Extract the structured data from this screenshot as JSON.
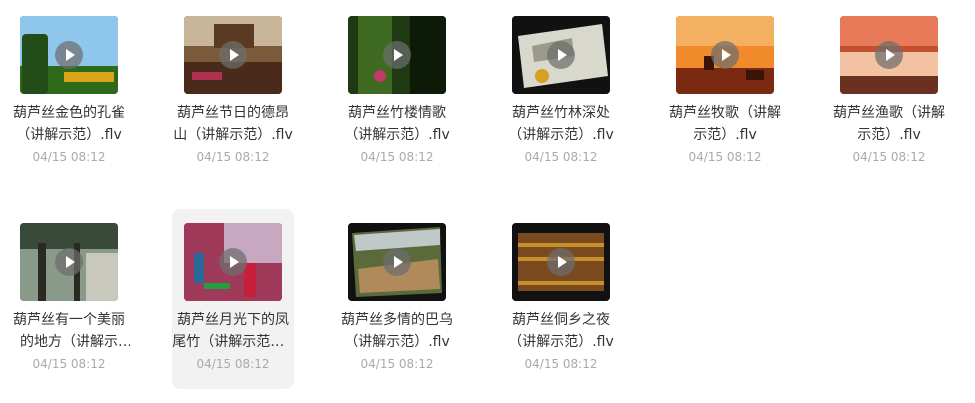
{
  "files": [
    {
      "name": "葫芦丝金色的孔雀（讲解示范）.flv",
      "date": "04/15 08:12",
      "thumb": "landscape-peacock-icon",
      "colors": [
        "#8fc7ec",
        "#2f6a1a",
        "#d9a31a"
      ]
    },
    {
      "name": "葫芦丝节日的德昂山（讲解示范）.flv",
      "date": "04/15 08:12",
      "thumb": "festival-crowd-icon",
      "colors": [
        "#7a5a3a",
        "#c9b59a",
        "#4a2a1a"
      ]
    },
    {
      "name": "葫芦丝竹楼情歌（讲解示范）.flv",
      "date": "04/15 08:12",
      "thumb": "bamboo-house-icon",
      "colors": [
        "#1f3a12",
        "#3e6a22",
        "#c13a6a"
      ]
    },
    {
      "name": "葫芦丝竹林深处（讲解示范）.flv",
      "date": "04/15 08:12",
      "thumb": "bamboo-forest-icon",
      "colors": [
        "#111111",
        "#d8d8cc",
        "#9a9a8a"
      ]
    },
    {
      "name": "葫芦丝牧歌（讲解示范）.flv",
      "date": "04/15 08:12",
      "thumb": "sunset-herder-icon",
      "colors": [
        "#f08a2a",
        "#f2b060",
        "#7a2a10"
      ]
    },
    {
      "name": "葫芦丝渔歌（讲解示范）.flv",
      "date": "04/15 08:12",
      "thumb": "lake-sunset-icon",
      "colors": [
        "#e87a5a",
        "#f2c2a2",
        "#6a3020"
      ]
    },
    {
      "name": "葫芦丝有一个美丽的地方（讲解示范）.flv",
      "date": "04/15 08:12",
      "thumb": "banyan-tree-icon",
      "colors": [
        "#8a9a8a",
        "#3a4a3a",
        "#c8c8bc"
      ]
    },
    {
      "name": "葫芦丝月光下的凤尾竹（讲解示范）.flv",
      "date": "04/15 08:12",
      "thumb": "dancers-icon",
      "colors": [
        "#a03a5a",
        "#c8a8c0",
        "#2a6a9a"
      ]
    },
    {
      "name": "葫芦丝多情的巴乌（讲解示范）.flv",
      "date": "04/15 08:12",
      "thumb": "mountain-village-icon",
      "colors": [
        "#111111",
        "#5a6a3a",
        "#b08a5a"
      ]
    },
    {
      "name": "葫芦丝侗乡之夜（讲解示范）.flv",
      "date": "04/15 08:12",
      "thumb": "terrace-night-icon",
      "colors": [
        "#111111",
        "#7a4a20",
        "#c8902a"
      ]
    }
  ]
}
